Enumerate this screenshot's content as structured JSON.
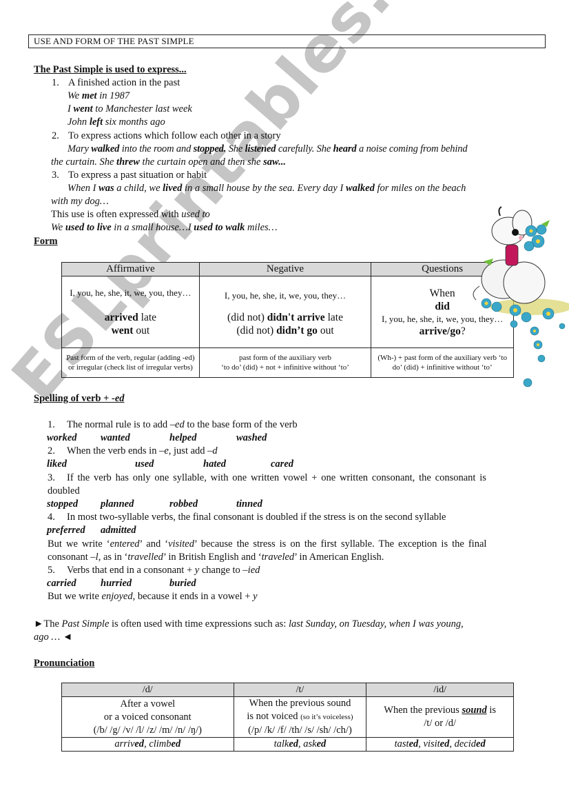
{
  "title": "USE AND FORM OF THE PAST SIMPLE",
  "uses": {
    "heading": "The Past Simple is used to express...",
    "items": [
      {
        "number": "1.",
        "label": "A finished action in the past",
        "examples": [
          {
            "pre": "We ",
            "bold": "met",
            "post": " in 1987"
          },
          {
            "pre": "I ",
            "bold": "went",
            "post": " to Manchester last week"
          },
          {
            "pre": "John ",
            "bold": "left",
            "post": " six months ago"
          }
        ]
      },
      {
        "number": "2.",
        "label": "To express actions which follow each other in a story",
        "example_line1": [
          "Mary ",
          "walked",
          " into the room and ",
          "stopped.",
          " She ",
          "listened",
          " carefully. She ",
          "heard",
          " a noise coming from behind"
        ],
        "example_line2": [
          "the curtain. She ",
          "threw",
          " the curtain open and then she ",
          "saw..."
        ]
      },
      {
        "number": "3.",
        "label": "To express a past situation or habit",
        "example_line1": [
          "When I ",
          "was",
          " a child, we ",
          "lived",
          " in a small house by the sea. Every day I ",
          "walked",
          " for miles on the beach"
        ],
        "example_line2": "with my dog…",
        "note_pre": "This use is often expressed with ",
        "note_italic": "used to",
        "used_to_example": [
          "We ",
          "used to live",
          " in a small house…I ",
          "used to walk",
          " miles…"
        ]
      }
    ]
  },
  "form": {
    "heading": "Form",
    "headers": [
      "Affirmative",
      "Negative",
      "Questions"
    ],
    "affirmative": {
      "subjects": "I, you, he, she, it, we, you, they…",
      "line1_bold": "arrived",
      "line1_rest": " late",
      "line2_bold": "went",
      "line2_rest": " out",
      "note": "Past form of the verb, regular (adding -ed) or irregular (check list of irregular verbs)"
    },
    "negative": {
      "subjects": "I, you, he, she, it, we, you, they…",
      "line1_pre": "(did not) ",
      "line1_bold": "didn't arrive",
      "line1_rest": " late",
      "line2_pre": "(did not) ",
      "line2_bold": "didn’t go",
      "line2_rest": " out",
      "note_line1": "past form of the auxiliary verb",
      "note_line2": "‘to do’ (did) + not + infinitive without ‘to’"
    },
    "questions": {
      "wh": "When",
      "aux": "did",
      "subjects": "I, you, he, she, it, we, you, they…",
      "verb_bold": "arrive/go",
      "verb_rest": "?",
      "note": "(Wh-) + past form of the auxiliary verb ‘to do’ (did) + infinitive without ‘to’"
    }
  },
  "spelling": {
    "heading_plain": "Spelling of verb + ",
    "heading_italic": "-ed",
    "rules": [
      {
        "number": "1.",
        "text_pre": "The normal rule is to add ",
        "text_italic": "–ed",
        "text_post": " to the base form of the verb",
        "examples": [
          "worked",
          "wanted",
          "helped",
          "washed"
        ]
      },
      {
        "number": "2.",
        "text_pre": "When the verb ends in ",
        "text_italic": "–e",
        "text_post": ", just add ",
        "text_italic2": "–d",
        "examples": [
          "liked",
          "used",
          "hated",
          "cared"
        ]
      },
      {
        "number": "3.",
        "text_line1": "If the verb has only one syllable, with one written vowel + one written consonant, the consonant is",
        "text_line2": "doubled",
        "examples": [
          "stopped",
          "planned",
          "robbed",
          "tinned"
        ]
      },
      {
        "number": "4.",
        "text": "In most two-syllable verbs, the final consonant is doubled if the stress is on the second syllable",
        "examples": [
          "preferred",
          "admitted"
        ]
      },
      {
        "number": "5.",
        "text_pre": "Verbs that end in a consonant + ",
        "text_italic": "y",
        "text_post": " change to ",
        "text_italic2": "–ied",
        "examples": [
          "carried",
          "hurried",
          "buried"
        ]
      }
    ],
    "exception": {
      "line1": [
        "But we write ‘",
        "entered",
        "’ and ‘",
        "visited",
        "’ because the stress is on the first syllable. The exception is the final"
      ],
      "line2": [
        "consonant ",
        "–l",
        ", as in ‘",
        "travelled",
        "’ in British English and ‘",
        "traveled",
        "’ in American English."
      ]
    },
    "enjoyed_note": [
      "But we write ",
      "enjoyed",
      ", because it ends in a vowel + ",
      "y"
    ]
  },
  "time_expressions": {
    "arrow_right": "►",
    "arrow_left": "◄",
    "pre": "The ",
    "italic1": "Past Simple",
    "mid": " is often used with time expressions such as: ",
    "italic2": "last Sunday, on Tuesday, when I was young,",
    "line2_italic": "ago …"
  },
  "pronunciation": {
    "heading": "Pronunciation",
    "headers": [
      "/d/",
      "/t/",
      "/id/"
    ],
    "d": {
      "line1": "After a vowel",
      "line2": "or a voiced consonant",
      "line3": "(/b/ /g/ /v/ /l/ /z/ /m/ /n/ /ŋ/)",
      "examples": [
        [
          "arriv",
          "ed"
        ],
        [
          "climb",
          "ed"
        ]
      ]
    },
    "t": {
      "line1": "When the previous sound",
      "line2": "is not voiced ",
      "line2_small": "(so it’s voiceless)",
      "line3": "(/p/ /k/ /f/ /th/ /s/ /sh/ /ch/)",
      "examples": [
        [
          "talk",
          "ed"
        ],
        [
          "ask",
          "ed"
        ]
      ]
    },
    "id": {
      "line1_pre": "When the previous ",
      "line1_bold": "sound",
      "line1_post": " is",
      "line2": "/t/ or /d/",
      "examples": [
        [
          "tast",
          "ed"
        ],
        [
          "visit",
          "ed"
        ],
        [
          "decid",
          "ed"
        ]
      ]
    }
  },
  "watermark": "ESLprintables.com",
  "colors": {
    "header_bg": "#d9d9d9",
    "watermark": "#969696"
  }
}
